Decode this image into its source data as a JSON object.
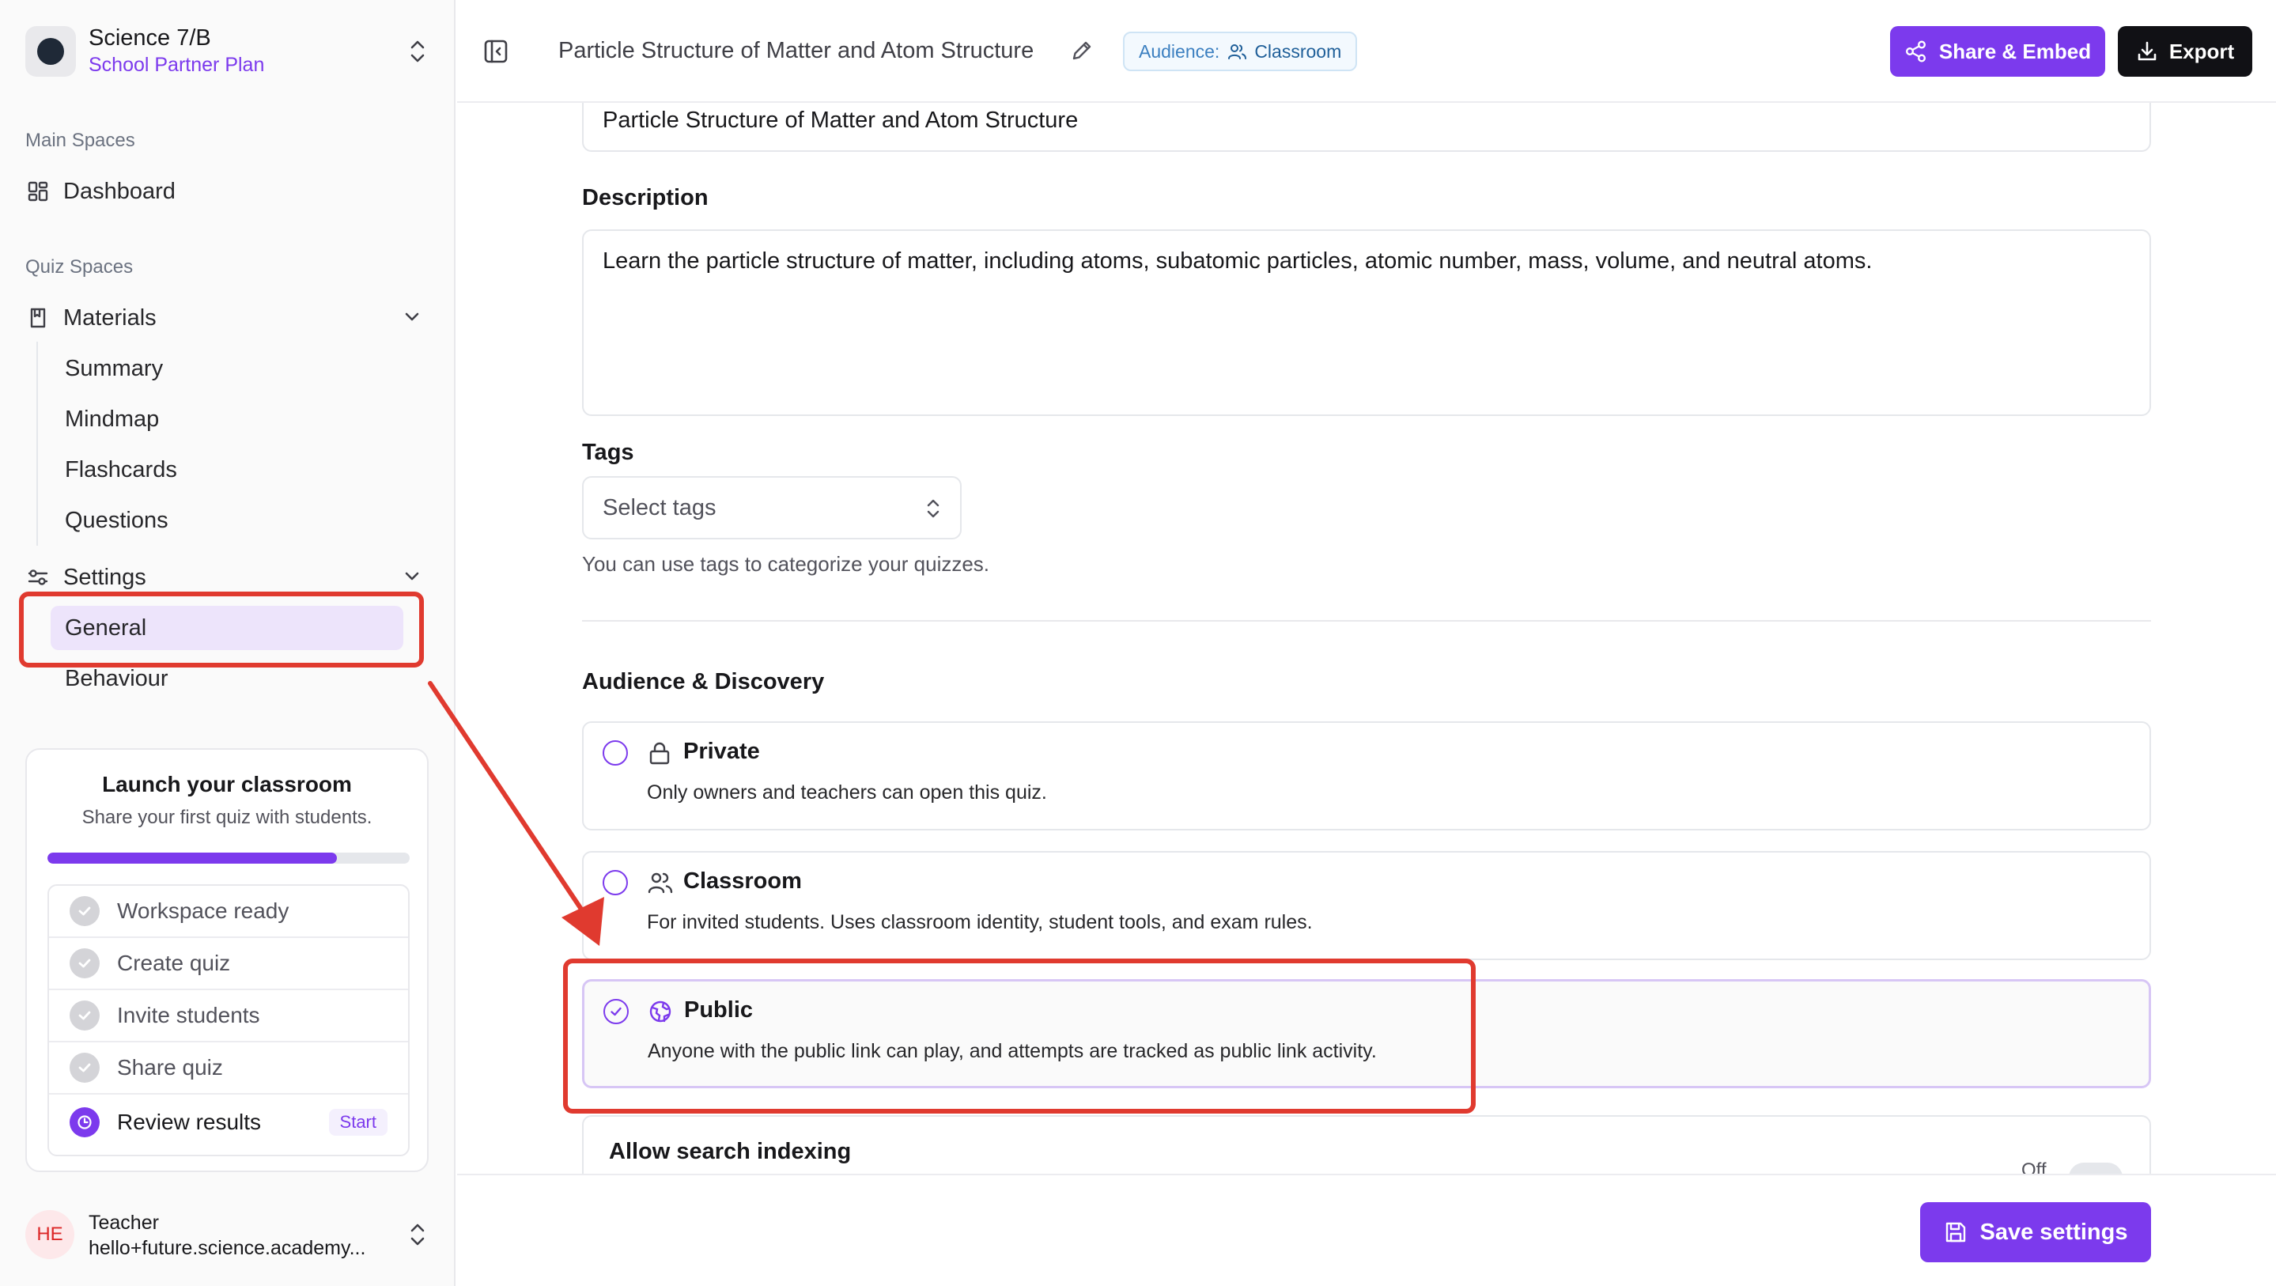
{
  "workspace": {
    "name": "Science 7/B",
    "plan": "School Partner Plan"
  },
  "sidebar": {
    "main_spaces_label": "Main Spaces",
    "dashboard_label": "Dashboard",
    "quiz_spaces_label": "Quiz Spaces",
    "materials_label": "Materials",
    "materials_items": [
      "Summary",
      "Mindmap",
      "Flashcards",
      "Questions"
    ],
    "settings_label": "Settings",
    "settings_items": [
      "General",
      "Behaviour"
    ]
  },
  "onboarding": {
    "title": "Launch your classroom",
    "subtitle": "Share your first quiz with students.",
    "progress_fraction": 0.8,
    "steps": [
      "Workspace ready",
      "Create quiz",
      "Invite students",
      "Share quiz",
      "Review results"
    ],
    "start_label": "Start"
  },
  "user": {
    "initials": "HE",
    "role": "Teacher",
    "email": "hello+future.science.academy..."
  },
  "header": {
    "title": "Particle Structure of Matter and Atom Structure",
    "audience_label": "Audience:",
    "audience_value": "Classroom",
    "share_label": "Share & Embed",
    "export_label": "Export"
  },
  "form": {
    "title_value": "Particle Structure of Matter and Atom Structure",
    "description_label": "Description",
    "description_value": "Learn the particle structure of matter, including atoms, subatomic particles, atomic number, mass, volume, and neutral atoms.",
    "tags_label": "Tags",
    "tags_placeholder": "Select tags",
    "tags_help": "You can use tags to categorize your quizzes.",
    "audience_section_label": "Audience & Discovery",
    "options": [
      {
        "title": "Private",
        "desc": "Only owners and teachers can open this quiz.",
        "icon": "lock-icon"
      },
      {
        "title": "Classroom",
        "desc": "For invited students. Uses classroom identity, student tools, and exam rules.",
        "icon": "users-icon"
      },
      {
        "title": "Public",
        "desc": "Anyone with the public link can play, and attempts are tracked as public link activity.",
        "icon": "globe-icon"
      }
    ],
    "selected_option": "Public",
    "indexing_label": "Allow search indexing",
    "indexing_toggle_text": "Off"
  },
  "footer": {
    "save_label": "Save settings"
  },
  "colors": {
    "accent": "#7c3aed",
    "annotation": "#e03a2f"
  }
}
